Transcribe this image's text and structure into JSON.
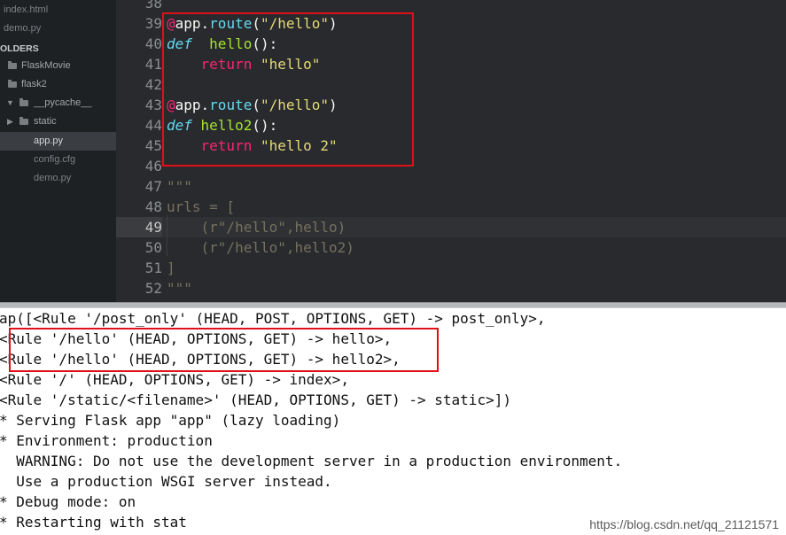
{
  "sidebar": {
    "open_files": [
      "index.html",
      "demo.py"
    ],
    "folders_header": "OLDERS",
    "tree": [
      {
        "label": "FlaskMovie",
        "kind": "folder",
        "expanded": false
      },
      {
        "label": "flask2",
        "kind": "folder",
        "expanded": false
      },
      {
        "label": "__pycache__",
        "kind": "folder",
        "expanded": true
      },
      {
        "label": "static",
        "kind": "folder",
        "expanded": false
      },
      {
        "label": "app.py",
        "kind": "file",
        "selected": true
      },
      {
        "label": "config.cfg",
        "kind": "file",
        "selected": false
      },
      {
        "label": "demo.py",
        "kind": "file",
        "selected": false
      }
    ]
  },
  "editor": {
    "active_line": 49,
    "lines": [
      {
        "num": "38",
        "tokens": []
      },
      {
        "num": "39",
        "tokens": [
          [
            "deco",
            "@"
          ],
          [
            "name",
            "app."
          ],
          [
            "func",
            "route"
          ],
          [
            "punc",
            "("
          ],
          [
            "str",
            "\"/hello\""
          ],
          [
            "punc",
            ")"
          ]
        ]
      },
      {
        "num": "40",
        "tokens": [
          [
            "def",
            "def"
          ],
          [
            "punc",
            "  "
          ],
          [
            "fn",
            "hello"
          ],
          [
            "punc",
            "():"
          ]
        ]
      },
      {
        "num": "41",
        "tokens": [
          [
            "punc",
            "    "
          ],
          [
            "ret",
            "return"
          ],
          [
            "punc",
            " "
          ],
          [
            "str",
            "\"hello\""
          ]
        ]
      },
      {
        "num": "42",
        "tokens": []
      },
      {
        "num": "43",
        "tokens": [
          [
            "deco",
            "@"
          ],
          [
            "name",
            "app."
          ],
          [
            "func",
            "route"
          ],
          [
            "punc",
            "("
          ],
          [
            "str",
            "\"/hello\""
          ],
          [
            "punc",
            ")"
          ]
        ]
      },
      {
        "num": "44",
        "tokens": [
          [
            "def",
            "def"
          ],
          [
            "punc",
            " "
          ],
          [
            "fn",
            "hello2"
          ],
          [
            "punc",
            "():"
          ]
        ]
      },
      {
        "num": "45",
        "tokens": [
          [
            "punc",
            "    "
          ],
          [
            "ret",
            "return"
          ],
          [
            "punc",
            " "
          ],
          [
            "str",
            "\"hello 2\""
          ]
        ]
      },
      {
        "num": "46",
        "tokens": []
      },
      {
        "num": "47",
        "tokens": [
          [
            "cmt",
            "\"\"\""
          ]
        ]
      },
      {
        "num": "48",
        "tokens": [
          [
            "cmt",
            "urls = ["
          ]
        ]
      },
      {
        "num": "49",
        "tokens": [
          [
            "cmt",
            "    (r\"/hello\",hello)"
          ]
        ]
      },
      {
        "num": "50",
        "tokens": [
          [
            "cmt",
            "    (r\"/hello\",hello2)"
          ]
        ]
      },
      {
        "num": "51",
        "tokens": [
          [
            "cmt",
            "]"
          ]
        ]
      },
      {
        "num": "52",
        "tokens": [
          [
            "cmt",
            "\"\"\""
          ]
        ]
      }
    ]
  },
  "console": {
    "lines": [
      "ap([<Rule '/post_only' (HEAD, POST, OPTIONS, GET) -> post_only>,",
      "<Rule '/hello' (HEAD, OPTIONS, GET) -> hello>,",
      "<Rule '/hello' (HEAD, OPTIONS, GET) -> hello2>,",
      "<Rule '/' (HEAD, OPTIONS, GET) -> index>,",
      "<Rule '/static/<filename>' (HEAD, OPTIONS, GET) -> static>])",
      "* Serving Flask app \"app\" (lazy loading)",
      "* Environment: production",
      "  WARNING: Do not use the development server in a production environment.",
      "  Use a production WSGI server instead.",
      "* Debug mode: on",
      "* Restarting with stat"
    ]
  },
  "watermark": "https://blog.csdn.net/qq_21121571",
  "colors": {
    "highlight_box": "#e0101a",
    "editor_bg": "#282a2e",
    "sidebar_bg": "#1e2124"
  }
}
